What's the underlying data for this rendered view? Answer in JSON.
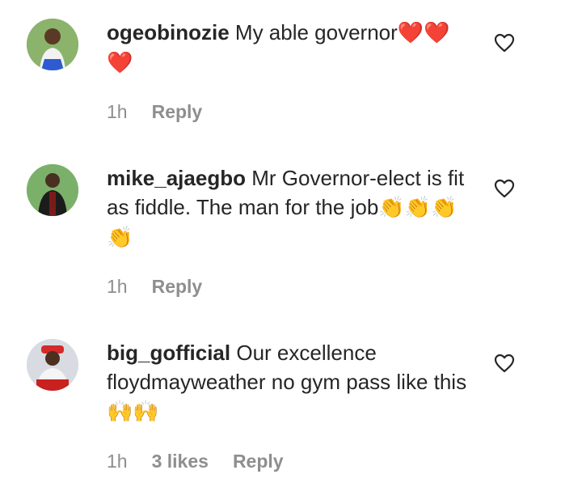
{
  "comments": [
    {
      "username": "ogeobinozie",
      "text": "My able governor",
      "emoji": "❤️❤️❤️",
      "time": "1h",
      "reply": "Reply"
    },
    {
      "username": "mike_ajaegbo",
      "text": "Mr Governor-elect is fit as fiddle. The man for the job",
      "emoji": "👏👏👏👏",
      "time": "1h",
      "reply": "Reply"
    },
    {
      "username": "big_gofficial",
      "text": "Our excellence floydmayweather no gym pass like this",
      "emoji": "🙌🙌",
      "time": "1h",
      "likes": "3 likes",
      "reply": "Reply"
    }
  ]
}
